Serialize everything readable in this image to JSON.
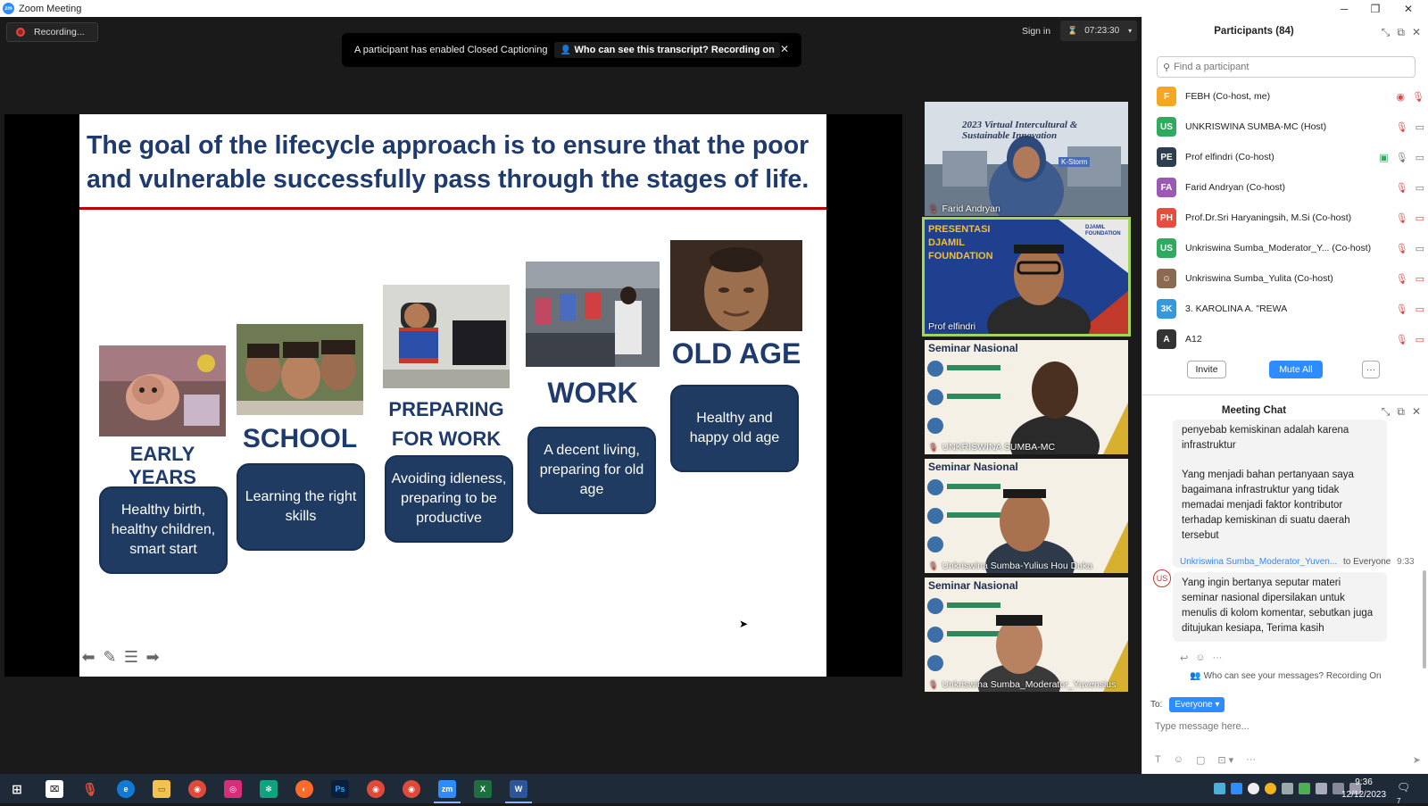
{
  "window": {
    "title": "Zoom Meeting"
  },
  "recording": {
    "label": "Recording..."
  },
  "cc_banner": {
    "message": "A participant has enabled Closed Captioning",
    "link": "Who can see this transcript? Recording on"
  },
  "header": {
    "sign_in": "Sign in",
    "timer": "07:23:30"
  },
  "slide": {
    "headline": "The goal of the lifecycle approach is to ensure that the poor and vulnerable successfully pass through the stages of life.",
    "stages": [
      {
        "title": "EARLY YEARS",
        "text": "Healthy birth, healthy children, smart start"
      },
      {
        "title": "SCHOOL",
        "text": "Learning the right skills"
      },
      {
        "title": "PREPARING FOR WORK",
        "text": "Avoiding idleness, preparing to be productive"
      },
      {
        "title": "WORK",
        "text": "A decent living, preparing for old age"
      },
      {
        "title": "OLD AGE",
        "text": "Healthy and happy old age"
      }
    ]
  },
  "tiles": [
    {
      "name": "Farid Andryan",
      "banner": "2023 Virtual Intercultural & Sustainable Innovation",
      "badge": "K-Storm"
    },
    {
      "name": "Prof elfindri",
      "banner": "PRESENTASI DJAMIL FOUNDATION",
      "logo": "DJAMIL FOUNDATION"
    },
    {
      "name": "UNKRISWINA SUMBA-MC",
      "banner": "Seminar Nasional"
    },
    {
      "name": "Unkriswina Sumba-Yulius Hou Duka",
      "banner": "Seminar Nasional"
    },
    {
      "name": "Unkriswina Sumba_Moderator_Yuvensius",
      "banner": "Seminar Nasional"
    }
  ],
  "participants": {
    "title": "Participants (84)",
    "search_placeholder": "Find a participant",
    "list": [
      {
        "initials": "F",
        "name": "FEBH (Co-host, me)",
        "color": "#f5a623"
      },
      {
        "initials": "US",
        "name": "UNKRISWINA SUMBA-MC (Host)",
        "color": "#2eab5f"
      },
      {
        "initials": "PE",
        "name": "Prof elfindri (Co-host)",
        "color": "#2c3e50"
      },
      {
        "initials": "FA",
        "name": "Farid Andryan (Co-host)",
        "color": "#9b59b6"
      },
      {
        "initials": "PH",
        "name": "Prof.Dr.Sri Haryaningsih, M.Si (Co-host)",
        "color": "#e74c3c"
      },
      {
        "initials": "US",
        "name": "Unkriswina Sumba_Moderator_Y... (Co-host)",
        "color": "#2eab5f"
      },
      {
        "initials": "",
        "name": "Unkriswina Sumba_Yulita (Co-host)",
        "color": "#8a6a50"
      },
      {
        "initials": "3K",
        "name": "3. KAROLINA A. \"REWA",
        "color": "#3498db"
      },
      {
        "initials": "A",
        "name": "A12",
        "color": "#333333"
      }
    ],
    "invite_label": "Invite",
    "mute_all_label": "Mute All",
    "more_label": "···"
  },
  "chat": {
    "title": "Meeting Chat",
    "message1_tail": "penyebab kemiskinan  adalah karena infrastruktur",
    "message1_body": "Yang menjadi bahan pertanyaan saya bagaimana infrastruktur yang tidak memadai menjadi faktor kontributor terhadap kemiskinan di suatu daerah tersebut",
    "message2_sender": "Unkriswina Sumba_Moderator_Yuven...",
    "message2_to": "to Everyone",
    "message2_time": "9:33",
    "message2_avatar": "US",
    "message2_body": "Yang ingin bertanya seputar materi seminar nasional dipersilakan untuk menulis di kolom komentar, sebutkan juga ditujukan kesiapa, Terima kasih",
    "notice": "Who can see your messages? Recording On",
    "to_label": "To:",
    "recipient": "Everyone",
    "input_placeholder": "Type message here..."
  },
  "taskbar": {
    "time": "9:36",
    "date": "12/12/2023",
    "notifications": "7"
  }
}
